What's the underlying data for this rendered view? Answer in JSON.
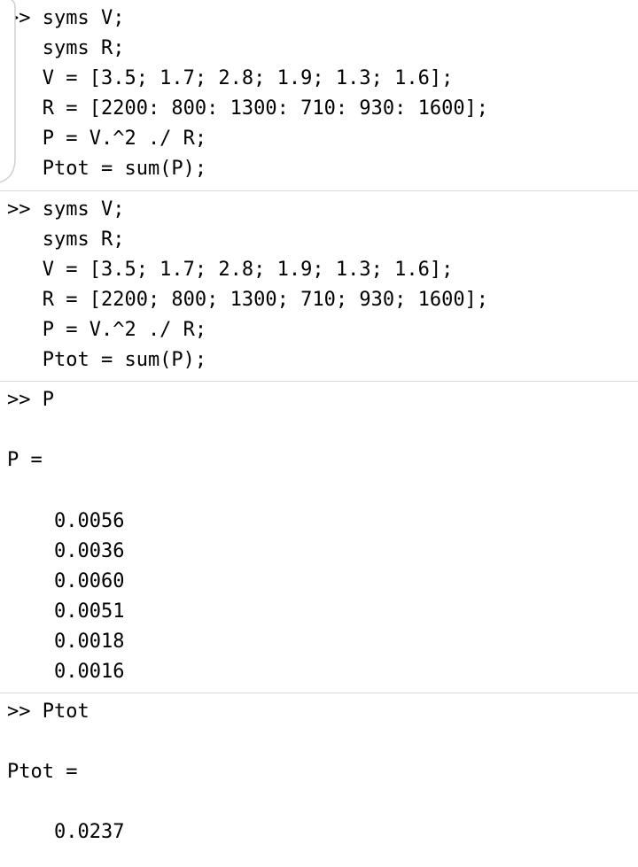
{
  "cells": {
    "c0": {
      "line0": ">> syms V;",
      "line1": "   syms R;",
      "line2": "   V = [3.5; 1.7; 2.8; 1.9; 1.3; 1.6];",
      "line3": "   R = [2200: 800: 1300: 710: 930: 1600];",
      "line4": "   P = V.^2 ./ R;",
      "line5": "   Ptot = sum(P);"
    },
    "c1": {
      "line0": ">> syms V;",
      "line1": "   syms R;",
      "line2": "   V = [3.5; 1.7; 2.8; 1.9; 1.3; 1.6];",
      "line3": "   R = [2200; 800; 1300; 710; 930; 1600];",
      "line4": "   P = V.^2 ./ R;",
      "line5": "   Ptot = sum(P);"
    },
    "c2": {
      "line0": ">> P",
      "line1": "",
      "line2": "P =",
      "line3": "",
      "line4": "    0.0056",
      "line5": "    0.0036",
      "line6": "    0.0060",
      "line7": "    0.0051",
      "line8": "    0.0018",
      "line9": "    0.0016"
    },
    "c3": {
      "line0": ">> Ptot",
      "line1": "",
      "line2": "Ptot =",
      "line3": "",
      "line4": "    0.0237"
    }
  }
}
